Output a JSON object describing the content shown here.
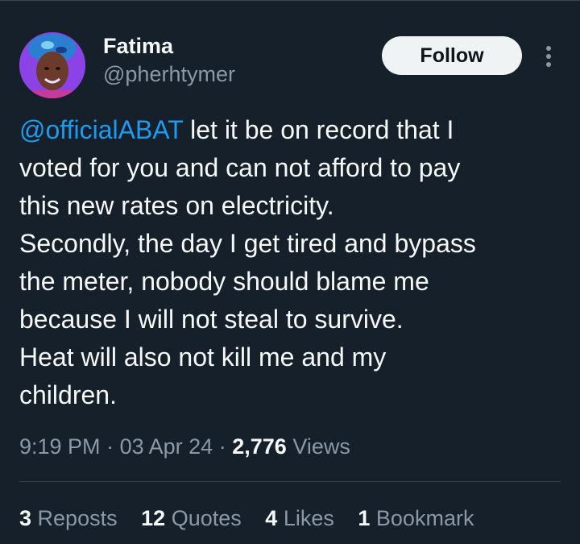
{
  "tweet": {
    "author": {
      "display_name": "Fatima",
      "handle": "@pherhtymer"
    },
    "follow_label": "Follow",
    "more_icon": "more-vertical-icon",
    "body": {
      "mention": "@officialABAT",
      "lines": [
        " let it be on record that I",
        "voted for you and can not afford to pay",
        "this new rates on electricity.",
        "Secondly, the day I get tired and bypass",
        "the meter, nobody should blame me",
        "because I will not steal to survive.",
        "Heat will also not kill me and my",
        "children."
      ]
    },
    "meta": {
      "time": "9:19 PM",
      "separator": "·",
      "date": "03 Apr 24",
      "views_count": "2,776",
      "views_label": "Views"
    },
    "stats": [
      {
        "count": "3",
        "label": "Reposts"
      },
      {
        "count": "12",
        "label": "Quotes"
      },
      {
        "count": "4",
        "label": "Likes"
      },
      {
        "count": "1",
        "label": "Bookmark"
      }
    ]
  },
  "colors": {
    "background": "#15202b",
    "text": "#f7f9f9",
    "secondary_text": "#8b98a5",
    "mention": "#1d9bf0",
    "follow_button_bg": "#eff3f4",
    "divider": "#38444d"
  }
}
